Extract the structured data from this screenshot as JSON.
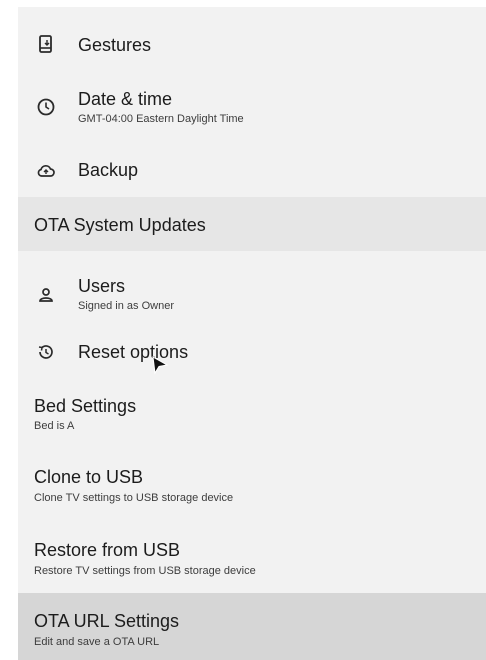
{
  "settings": {
    "items": [
      {
        "title": "Gestures",
        "icon": "gestures-icon"
      },
      {
        "title": "Date & time",
        "subtitle": "GMT-04:00 Eastern Daylight Time",
        "icon": "clock-icon"
      },
      {
        "title": "Backup",
        "icon": "cloud-upload-icon"
      },
      {
        "title": "OTA System Updates"
      },
      {
        "title": "Users",
        "subtitle": "Signed in as Owner",
        "icon": "user-icon"
      },
      {
        "title": "Reset options",
        "icon": "reset-icon"
      },
      {
        "title": "Bed Settings",
        "subtitle": "Bed is A"
      },
      {
        "title": "Clone to USB",
        "subtitle": "Clone TV settings to USB storage device"
      },
      {
        "title": "Restore from USB",
        "subtitle": "Restore TV settings from USB storage device"
      },
      {
        "title": "OTA URL Settings",
        "subtitle": "Edit and save a OTA URL"
      }
    ]
  }
}
